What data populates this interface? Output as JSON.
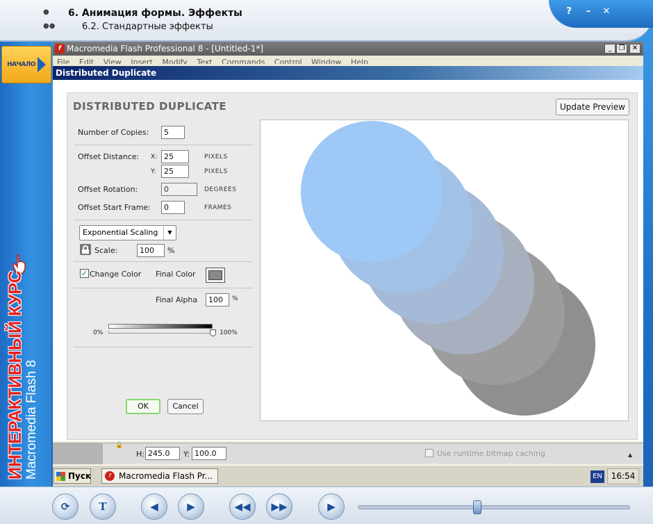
{
  "course": {
    "lesson_title": "6. Анимация формы. Эффекты",
    "lesson_subtitle": "6.2. Стандартные эффекты",
    "top_icons": [
      "?",
      "–",
      "✕"
    ],
    "start_label": "НАЧАЛО",
    "brand_red": "ИНТЕРАКТИВНЫЙ КУРС",
    "brand_white": "Macromedia Flash 8",
    "progress_fraction": 0.44,
    "accent_color": "#1f6fc4"
  },
  "flash": {
    "title": "Macromedia Flash Professional 8 - [Untitled-1*]",
    "menu": [
      "File",
      "Edit",
      "View",
      "Insert",
      "Modify",
      "Text",
      "Commands",
      "Control",
      "Window",
      "Help"
    ]
  },
  "dialog": {
    "title": "Distributed Duplicate",
    "heading": "DISTRIBUTED DUPLICATE",
    "update_preview": "Update Preview",
    "copies_label": "Number of Copies:",
    "copies_value": "5",
    "offset_distance_label": "Offset Distance:",
    "x_label": "X:",
    "x_value": "25",
    "y_label": "Y:",
    "y_value": "25",
    "pixels": "PIXELS",
    "rotation_label": "Offset Rotation:",
    "rotation_value": "0",
    "degrees": "DEGREES",
    "start_frame_label": "Offset Start Frame:",
    "start_frame_value": "0",
    "frames": "FRAMES",
    "scaling_option": "Exponential Scaling",
    "scale_label": "Scale:",
    "scale_value": "100",
    "percent": "%",
    "change_color_label": "Change Color",
    "change_color_checked": true,
    "final_color_label": "Final Color",
    "final_color": "#888888",
    "final_alpha_label": "Final Alpha",
    "final_alpha_value": "100",
    "alpha_min": "0%",
    "alpha_max": "100%",
    "ok": "OK",
    "cancel": "Cancel",
    "preview_colors": [
      "#9ec8f5",
      "#a1c1e6",
      "#a4bad6",
      "#a8b0c0",
      "#9c9c9c",
      "#8f8f8f"
    ]
  },
  "properties": {
    "h_label": "H:",
    "h_value": "245.0",
    "y_label": "Y:",
    "y_value": "100.0",
    "bitmap_caching": "Use runtime bitmap caching"
  },
  "taskbar": {
    "start": "Пуск",
    "item": "Macromedia Flash Pr...",
    "lang": "EN",
    "clock": "16:54"
  }
}
